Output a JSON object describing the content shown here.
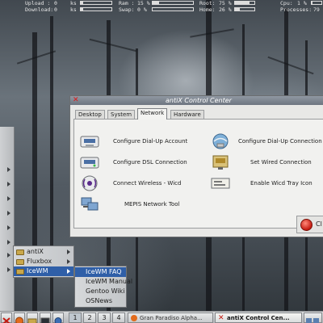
{
  "conky": {
    "upload_label": "Upload :",
    "upload_value": "0",
    "upload_unit": "ks",
    "download_label": "Download:",
    "download_value": "0",
    "download_unit": "ks",
    "ram_label": "Ram :",
    "ram_value": "15 %",
    "ram_fraction": 0.15,
    "swap_label": "Swap:",
    "swap_value": "0 %",
    "swap_fraction": 0.0,
    "root_label": "Root:",
    "root_value": "75 %",
    "root_fraction": 0.75,
    "home_label": "Home:",
    "home_value": "26 %",
    "home_fraction": 0.26,
    "cpu_label": "Cpu:",
    "cpu_value": "1 %",
    "cpu_fraction": 0.01,
    "processes_label": "Processes:",
    "processes_value": "79",
    "bar_color": "#dcdcdc"
  },
  "window": {
    "title": "antiX Control Center",
    "tabs": [
      {
        "label": "Desktop",
        "active": false
      },
      {
        "label": "System",
        "active": false
      },
      {
        "label": "Network",
        "active": true
      },
      {
        "label": "Hardware",
        "active": false
      }
    ],
    "items": [
      {
        "label": "Configure Dial-Up Account",
        "icon": "dialup-account-icon"
      },
      {
        "label": "Configure Dial-Up Connection",
        "icon": "dialup-connection-icon"
      },
      {
        "label": "Configure DSL Connection",
        "icon": "dsl-icon"
      },
      {
        "label": "Set Wired Connection",
        "icon": "wired-icon"
      },
      {
        "label": "Connect Wireless - Wicd",
        "icon": "wireless-icon"
      },
      {
        "label": "Enable Wicd Tray Icon",
        "icon": "tray-icon"
      },
      {
        "label": "MEPIS Network Tool",
        "icon": "network-tool-icon"
      }
    ],
    "close_label": "Cl",
    "accent_color": "#2f5fa8",
    "close_color": "#c41a10"
  },
  "menus": {
    "submenu": [
      {
        "label": "antiX",
        "selected": false
      },
      {
        "label": "Fluxbox",
        "selected": false
      },
      {
        "label": "IceWM",
        "selected": true
      }
    ],
    "icewm_menu": [
      {
        "label": "IceWM FAQ",
        "selected": true
      },
      {
        "label": "IceWM Manual",
        "selected": false
      },
      {
        "label": "Gentoo Wiki",
        "selected": false
      },
      {
        "label": "OSNews",
        "selected": false
      }
    ]
  },
  "taskbar": {
    "workspaces": [
      "1",
      "2",
      "3",
      "4"
    ],
    "tasks": [
      {
        "label": "Gran Paradiso Alpha...",
        "active": false
      },
      {
        "label": "antiX Control Cen...",
        "active": true
      }
    ]
  }
}
